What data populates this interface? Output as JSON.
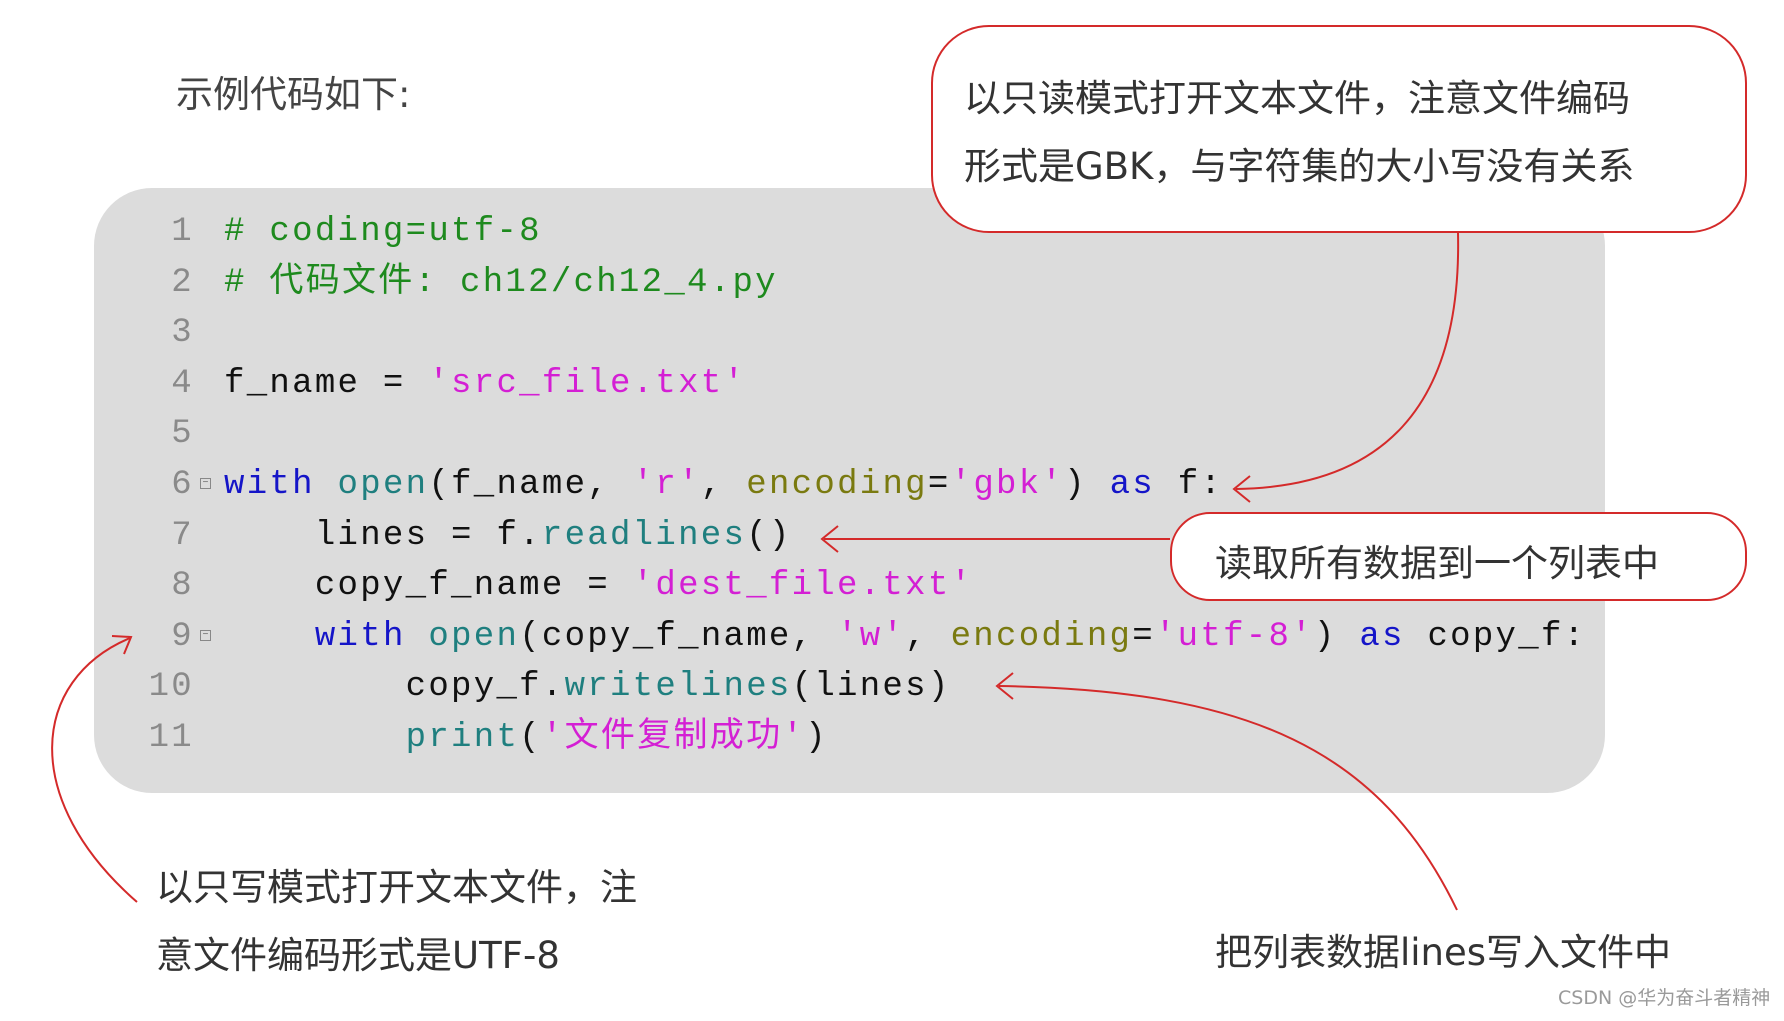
{
  "intro": "示例代码如下:",
  "code": {
    "lines": [
      {
        "num": "1",
        "fold": false,
        "tokens": [
          {
            "t": "comment",
            "v": "# coding=utf-8"
          }
        ]
      },
      {
        "num": "2",
        "fold": false,
        "tokens": [
          {
            "t": "comment",
            "v": "# 代码文件: ch12/ch12_4.py"
          }
        ]
      },
      {
        "num": "3",
        "fold": false,
        "tokens": []
      },
      {
        "num": "4",
        "fold": false,
        "tokens": [
          {
            "t": "plain",
            "v": "f_name = "
          },
          {
            "t": "str",
            "v": "'src_file.txt'"
          }
        ]
      },
      {
        "num": "5",
        "fold": false,
        "tokens": []
      },
      {
        "num": "6",
        "fold": true,
        "tokens": [
          {
            "t": "kw",
            "v": "with "
          },
          {
            "t": "fn",
            "v": "open"
          },
          {
            "t": "plain",
            "v": "(f_name, "
          },
          {
            "t": "str",
            "v": "'r'"
          },
          {
            "t": "plain",
            "v": ", "
          },
          {
            "t": "param",
            "v": "encoding"
          },
          {
            "t": "plain",
            "v": "="
          },
          {
            "t": "str",
            "v": "'gbk'"
          },
          {
            "t": "plain",
            "v": ") "
          },
          {
            "t": "kw",
            "v": "as"
          },
          {
            "t": "plain",
            "v": " f:"
          }
        ]
      },
      {
        "num": "7",
        "fold": false,
        "tokens": [
          {
            "t": "plain",
            "v": "    lines = f."
          },
          {
            "t": "fn",
            "v": "readlines"
          },
          {
            "t": "plain",
            "v": "()"
          }
        ]
      },
      {
        "num": "8",
        "fold": false,
        "tokens": [
          {
            "t": "plain",
            "v": "    copy_f_name = "
          },
          {
            "t": "str",
            "v": "'dest_file.txt'"
          }
        ]
      },
      {
        "num": "9",
        "fold": true,
        "tokens": [
          {
            "t": "plain",
            "v": "    "
          },
          {
            "t": "kw",
            "v": "with "
          },
          {
            "t": "fn",
            "v": "open"
          },
          {
            "t": "plain",
            "v": "(copy_f_name, "
          },
          {
            "t": "str",
            "v": "'w'"
          },
          {
            "t": "plain",
            "v": ", "
          },
          {
            "t": "param",
            "v": "encoding"
          },
          {
            "t": "plain",
            "v": "="
          },
          {
            "t": "str",
            "v": "'utf-8'"
          },
          {
            "t": "plain",
            "v": ") "
          },
          {
            "t": "kw",
            "v": "as"
          },
          {
            "t": "plain",
            "v": " copy_f:"
          }
        ]
      },
      {
        "num": "10",
        "fold": false,
        "tokens": [
          {
            "t": "plain",
            "v": "        copy_f."
          },
          {
            "t": "fn",
            "v": "writelines"
          },
          {
            "t": "plain",
            "v": "(lines)"
          }
        ]
      },
      {
        "num": "11",
        "fold": false,
        "tokens": [
          {
            "t": "plain",
            "v": "        "
          },
          {
            "t": "fn",
            "v": "print"
          },
          {
            "t": "plain",
            "v": "("
          },
          {
            "t": "str",
            "v": "'文件复制成功'"
          },
          {
            "t": "plain",
            "v": ")"
          }
        ]
      }
    ]
  },
  "annotations": {
    "top": [
      "以只读模式打开文本文件，注意文件编码",
      "形式是GBK，与字符集的大小写没有关系"
    ],
    "middle": "读取所有数据到一个列表中",
    "bottom_left": [
      "以只写模式打开文本文件，注",
      "意文件编码形式是UTF-8"
    ],
    "bottom_right": "把列表数据lines写入文件中"
  },
  "watermark": "CSDN @华为奋斗者精神",
  "colors": {
    "arrow": "#d42a2a",
    "code_bg": "#dcdcdc",
    "comment": "#1e8a1e",
    "keyword": "#1515c8",
    "function": "#1f7f7f",
    "string": "#d41fd4",
    "parameter": "#7a7a10"
  }
}
